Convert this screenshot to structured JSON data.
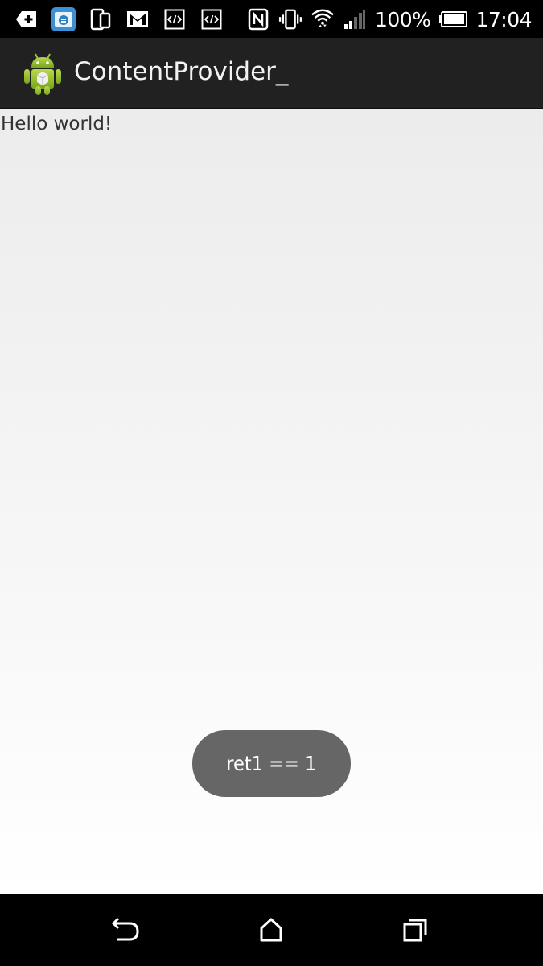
{
  "status_bar": {
    "battery_text": "100%",
    "time": "17:04",
    "left_icons": [
      "add-icon",
      "file-manager-icon",
      "devices-icon",
      "gmail-icon",
      "code-icon",
      "code-icon"
    ],
    "right_icons": [
      "nfc-icon",
      "vibrate-icon",
      "wifi-icon",
      "signal-icon",
      "battery-icon"
    ]
  },
  "action_bar": {
    "title": "ContentProvider_",
    "app_icon": "android-icon",
    "background": "#212121"
  },
  "main": {
    "text": "Hello world!"
  },
  "toast": {
    "message": "ret1 == 1",
    "background": "#666666"
  },
  "nav_bar": {
    "buttons": [
      "back-icon",
      "home-icon",
      "recents-icon"
    ]
  }
}
